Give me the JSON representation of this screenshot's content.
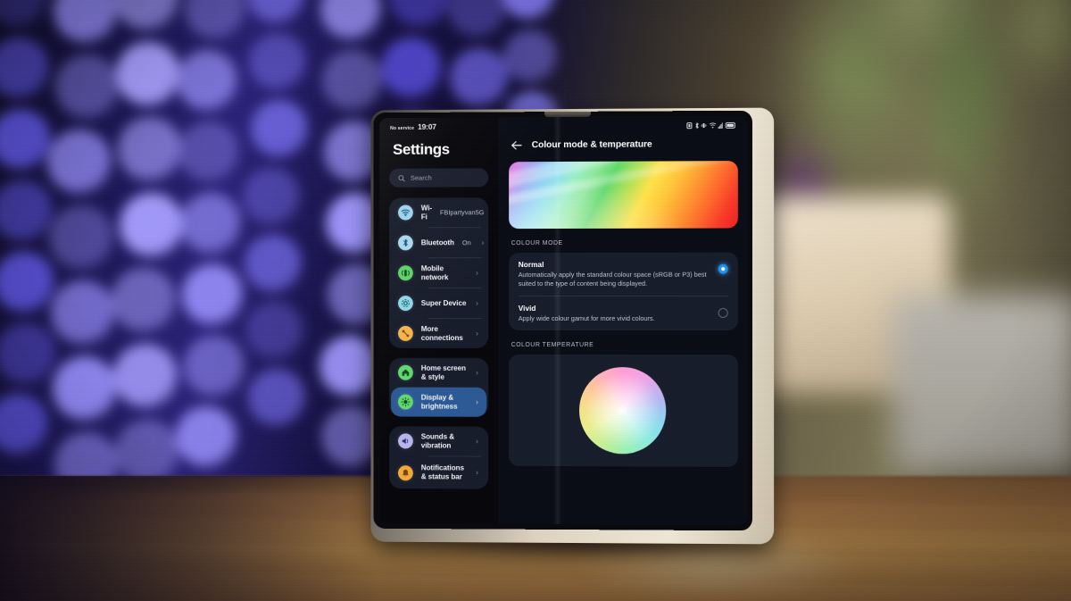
{
  "scene": {
    "description": "foldable-phone-on-wooden-table",
    "background": {
      "left": "blue-bokeh-lights",
      "right": "blurred-green-plant-and-cream-pot",
      "surface": "wooden-table"
    },
    "phone_frame_color": "#e3d8c4"
  },
  "statusbar": {
    "carrier": "No service",
    "time": "19:07",
    "icons": [
      "sim-icon",
      "bluetooth-icon",
      "vibrate-icon",
      "wifi-icon",
      "signal-icon",
      "battery-icon"
    ],
    "battery_level": "92"
  },
  "sidebar": {
    "title": "Settings",
    "search": {
      "placeholder": "Search",
      "value": ""
    },
    "groups": [
      {
        "items": [
          {
            "label": "Wi-Fi",
            "value": "FBIpartyvan5G",
            "icon": "wifi-icon",
            "color": "#9fd4ef",
            "selected": false
          },
          {
            "label": "Bluetooth",
            "value": "On",
            "icon": "bluetooth-icon",
            "color": "#a8d8f0",
            "selected": false
          },
          {
            "label": "Mobile network",
            "value": "",
            "icon": "mobile-network-icon",
            "color": "#5fd46a",
            "selected": false
          },
          {
            "label": "Super Device",
            "value": "",
            "icon": "super-device-icon",
            "color": "#8fd8e8",
            "selected": false
          },
          {
            "label": "More connections",
            "value": "",
            "icon": "more-connections-icon",
            "color": "#f5b44c",
            "selected": false
          }
        ]
      },
      {
        "items": [
          {
            "label": "Home screen & style",
            "value": "",
            "icon": "home-screen-icon",
            "color": "#62d96f",
            "selected": false
          },
          {
            "label": "Display & brightness",
            "value": "",
            "icon": "display-brightness-icon",
            "color": "#62d96f",
            "selected": true
          }
        ]
      },
      {
        "items": [
          {
            "label": "Sounds & vibration",
            "value": "",
            "icon": "sound-icon",
            "color": "#b7b6ee",
            "selected": false
          },
          {
            "label": "Notifications & status bar",
            "value": "",
            "icon": "notifications-icon",
            "color": "#f5a93c",
            "selected": false
          }
        ]
      }
    ]
  },
  "detail": {
    "title": "Colour mode & temperature",
    "back_label": "back-arrow",
    "banner": "rainbow-gradient-preview",
    "colour_mode": {
      "section_label": "COLOUR MODE",
      "options": [
        {
          "title": "Normal",
          "desc": "Automatically apply the standard colour space (sRGB or P3) best suited to the type of content being displayed.",
          "selected": true
        },
        {
          "title": "Vivid",
          "desc": "Apply wide colour gamut for more vivid colours.",
          "selected": false
        }
      ]
    },
    "colour_temperature": {
      "section_label": "COLOUR TEMPERATURE",
      "control": "colour-wheel",
      "handle_position": "center"
    }
  },
  "colors": {
    "accent_blue": "#2196f3",
    "card_bg": "#181d2b",
    "screen_bg": "#08080c",
    "selected_row": "#2c5a94",
    "text_primary": "#ffffff",
    "text_secondary": "#bcc3d0"
  }
}
